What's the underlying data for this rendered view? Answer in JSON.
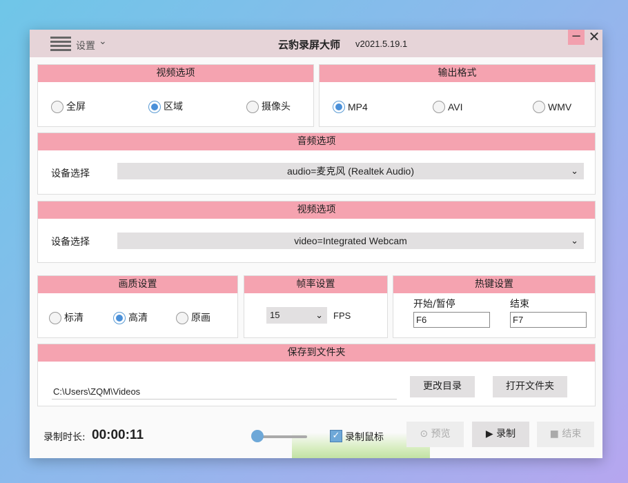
{
  "window": {
    "settings_label": "设置",
    "title": "云豹录屏大师",
    "version": "v2021.5.19.1",
    "minimize_glyph": "−",
    "close_glyph": "✕"
  },
  "video_options": {
    "title": "视频选项",
    "options": [
      "全屏",
      "区域",
      "摄像头"
    ],
    "selected": "区域"
  },
  "output_format": {
    "title": "输出格式",
    "options": [
      "MP4",
      "AVI",
      "WMV"
    ],
    "selected": "MP4"
  },
  "audio_options": {
    "title": "音频选项",
    "device_label": "设备选择",
    "device_value": "audio=麦克风 (Realtek Audio)"
  },
  "video_device": {
    "title": "视频选项",
    "device_label": "设备选择",
    "device_value": "video=Integrated Webcam"
  },
  "quality": {
    "title": "画质设置",
    "options": [
      "标清",
      "高清",
      "原画"
    ],
    "selected": "高清"
  },
  "framerate": {
    "title": "帧率设置",
    "value": "15",
    "unit": "FPS"
  },
  "hotkeys": {
    "title": "热键设置",
    "start_label": "开始/暂停",
    "start_value": "F6",
    "end_label": "结束",
    "end_value": "F7"
  },
  "save_folder": {
    "title": "保存到文件夹",
    "path": "C:\\Users\\ZQM\\Videos",
    "change_button": "更改目录",
    "open_button": "打开文件夹"
  },
  "bottom": {
    "duration_label": "录制时长:",
    "duration_value": "00:00:11",
    "volume_level": 0,
    "record_cursor_label": "录制鼠标",
    "record_cursor_checked": true,
    "preview_button": "预览",
    "record_button": "录制",
    "stop_button": "结束"
  },
  "colors": {
    "accent_pink": "#f5a3b0",
    "titlebar": "#e6d4d8",
    "radio_blue": "#4a90d9"
  }
}
